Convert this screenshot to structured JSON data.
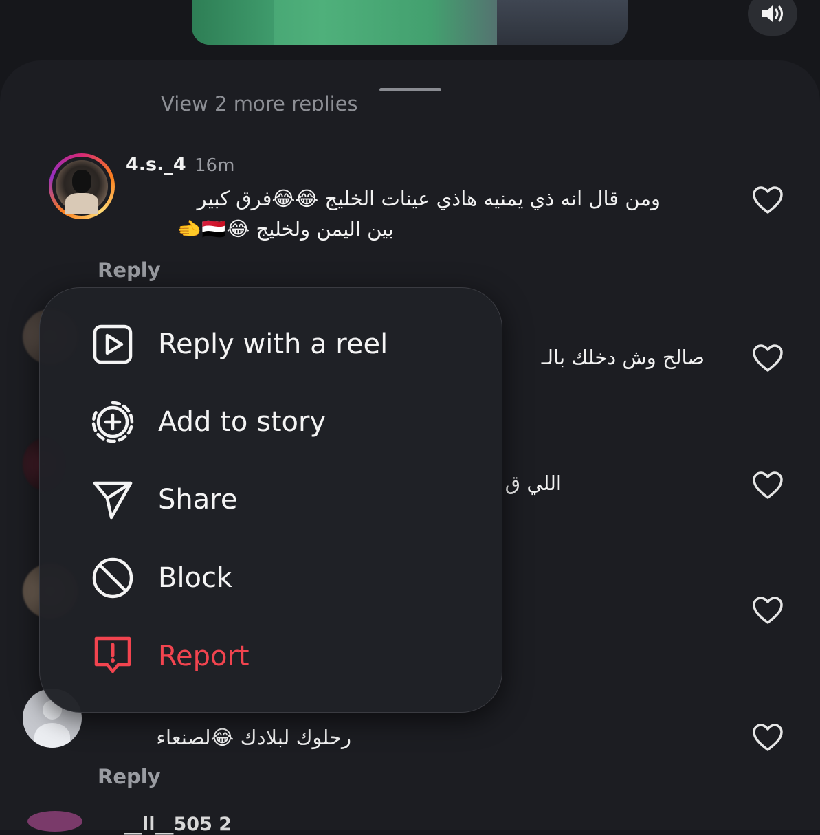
{
  "comments": {
    "view_more_replies": "View 2 more replies",
    "items": [
      {
        "username": "4.s._4",
        "time": "16m",
        "text_line1": "ومن قال انه ذي يمنيه هاذي عينات الخليج 😂😂فرق كبير",
        "text_line2": "بين اليمن ولخليج 😂🇾🇪🫲",
        "reply_label": "Reply"
      },
      {
        "text": "صالح وش دخلك بالـ"
      },
      {
        "text": "اللي ق"
      },
      {
        "text": ""
      },
      {
        "text": ""
      },
      {
        "text": "رحلوك لبلادك 😂لصنعاء",
        "reply_label": "Reply"
      }
    ],
    "bottom_username_partial": "__ll__505 2"
  },
  "context_menu": {
    "items": [
      {
        "label": "Reply with a reel",
        "icon": "reel-icon"
      },
      {
        "label": "Add to story",
        "icon": "add-story-icon"
      },
      {
        "label": "Share",
        "icon": "send-icon"
      },
      {
        "label": "Block",
        "icon": "block-icon"
      },
      {
        "label": "Report",
        "icon": "report-icon",
        "danger": true
      }
    ]
  },
  "colors": {
    "background": "#16171b",
    "sheet": "#1c1d22",
    "menu": "#202126",
    "danger": "#f2444f",
    "muted_text": "#9a9ca2"
  },
  "video": {
    "sound_icon": "speaker-icon"
  }
}
